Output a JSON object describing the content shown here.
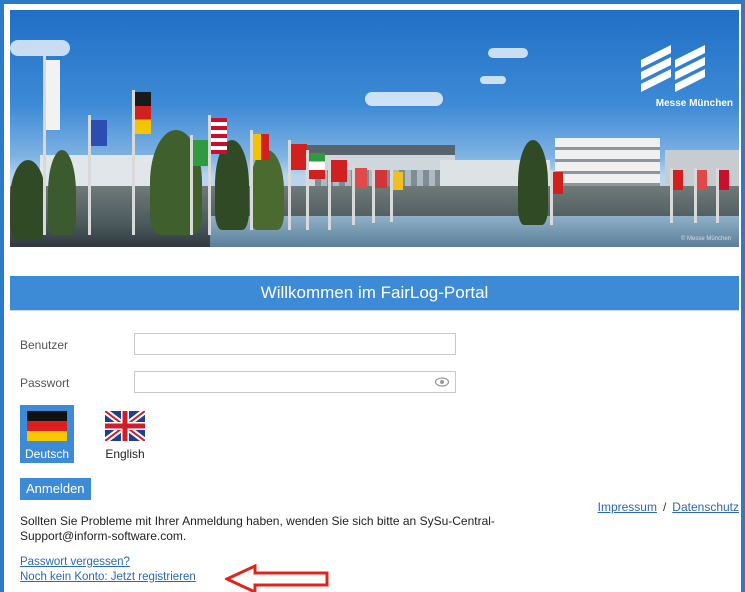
{
  "banner": {
    "logo_text": "Messe München",
    "copyright": "© Messe München"
  },
  "title": "Willkommen im FairLog-Portal",
  "form": {
    "user_label": "Benutzer",
    "user_value": "",
    "password_label": "Passwort",
    "password_value": ""
  },
  "languages": [
    {
      "label": "Deutsch",
      "selected": true
    },
    {
      "label": "English",
      "selected": false
    }
  ],
  "login_button": "Anmelden",
  "footer_links": {
    "impressum": "Impressum",
    "separator": "/",
    "datenschutz": "Datenschutz"
  },
  "help_text": "Sollten Sie Probleme mit Ihrer Anmeldung haben, wenden Sie sich bitte an SySu-Central-Support@inform-software.com.",
  "forgot_password": "Passwort vergessen?",
  "register": "Noch kein Konto: Jetzt registrieren",
  "colors": {
    "accent": "#3d8ad6",
    "link": "#2b68b5",
    "arrow": "#e0241b"
  }
}
